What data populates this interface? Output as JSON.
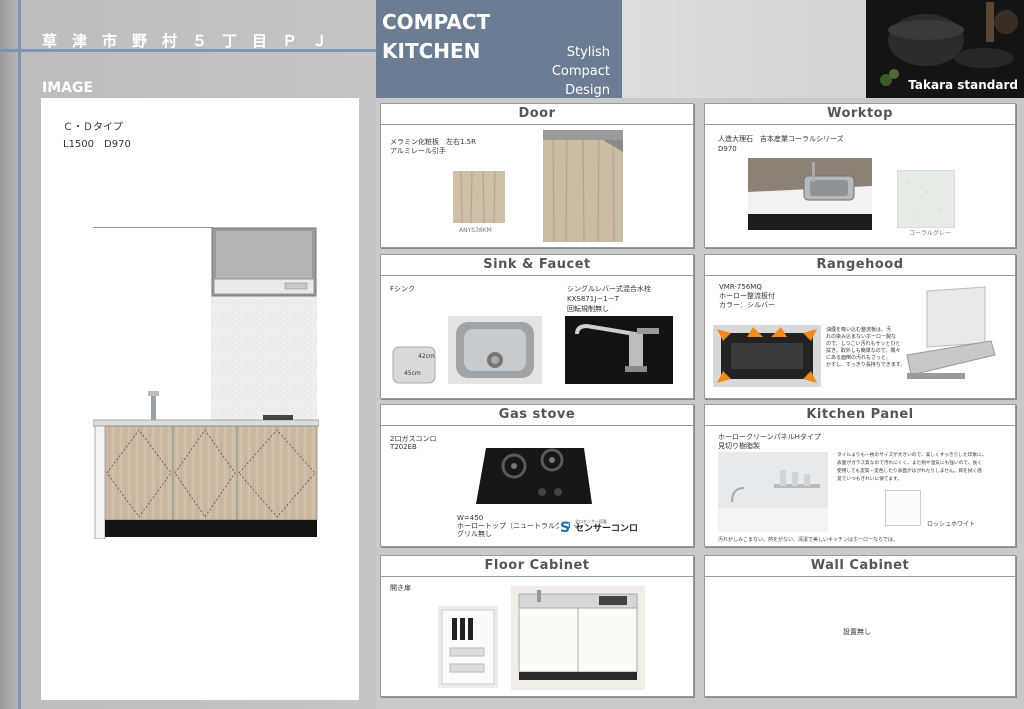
{
  "header": {
    "project_title": "草津市野村５丁目ＰＪ",
    "image_heading": "IMAGE",
    "title_line1": "COMPACT",
    "title_line2": "KITCHEN",
    "sub_line1": "Stylish",
    "sub_line2": "Compact",
    "sub_line3": "Design",
    "brand": "Takara standard"
  },
  "image_panel": {
    "type_label": "Ｃ・Ｄタイプ",
    "size_label": "L1500　D970"
  },
  "boxes": {
    "door": {
      "title": "Door",
      "spec1": "メラミン化粧板　左右1.5R",
      "spec2": "アルミレール引手",
      "swatch_caption": "ANYS38KM"
    },
    "worktop": {
      "title": "Worktop",
      "spec1": "人造大理石　吉本産業コーラルシリーズ",
      "spec2": "D970",
      "swatch_caption": "コーラルグレー"
    },
    "sink": {
      "title": "Sink & Faucet",
      "spec_sink": "Fシンク",
      "dim_h": "42cm",
      "dim_w": "45cm",
      "faucet1": "シングルレバー式混合水栓",
      "faucet2": "KXS871J－1－T",
      "faucet3": "回転規制無し"
    },
    "rangehood": {
      "title": "Rangehood",
      "spec1": "VMR-756MQ",
      "spec2": "ホーロー整流板付",
      "spec3": "カラー：シルバー",
      "note1": "油煙を吸い込む整流板は、汚",
      "note2": "れの染み込まないホーロー製な",
      "note3": "ので、しつこい汚れもサッとひと",
      "note4": "拭き。取外しも簡単なので、隅々",
      "note5": "にある面倒の汚れもさっと、",
      "note6": "かすし、すっきり長持ちできます。"
    },
    "gas": {
      "title": "Gas stove",
      "spec1": "2口ガスコンロ",
      "spec2": "T202EB",
      "spec3": "W=450",
      "spec4": "ホーロートップ（ニュートラルグレー）",
      "spec5": "グリル無し",
      "sensor_small": "全口センサー搭載",
      "sensor_label": "センサーコンロ"
    },
    "panel": {
      "title": "Kitchen Panel",
      "spec1": "ホーロークリーンパネルHタイプ",
      "spec2": "見切り樹脂製",
      "desc1": "タイルよりも一枚のサイズが大きいので、美しくすっきりした印象に。",
      "desc2": "表面がガラス質なので汚れにくく、また熱や湿気にも強いので、長く",
      "desc3": "使用しても変質・変色したり表面がはがれたりしません。目を拭く感",
      "desc4": "覚でいつもきれいに保てます。",
      "swatch_caption": "ロッシュホワイト",
      "footer": "汚れがしみこまない、熱をがない、清潔で美しいキッチンはホーローならでは。"
    },
    "floor": {
      "title": "Floor Cabinet",
      "spec1": "開き扉"
    },
    "wall": {
      "title": "Wall Cabinet",
      "none": "設置無し"
    }
  }
}
